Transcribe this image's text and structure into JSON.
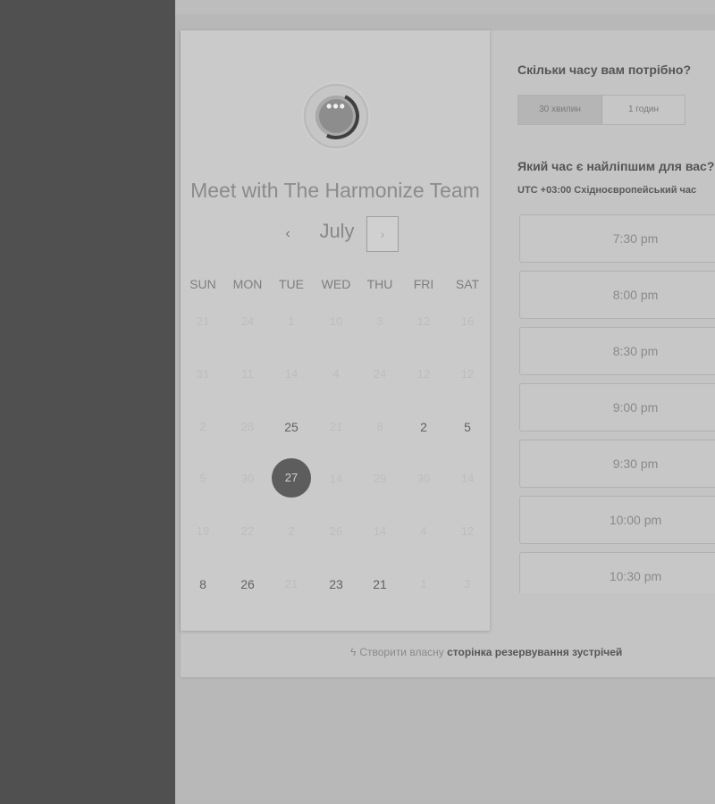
{
  "meeting": {
    "title": "Meet with The Harmonize Team",
    "avatar_icon": "chat-ellipsis-icon"
  },
  "calendar": {
    "month": "July",
    "prev_icon": "‹",
    "next_icon": "›",
    "weekdays": [
      "SUN",
      "MON",
      "TUE",
      "WED",
      "THU",
      "FRI",
      "SAT"
    ],
    "weeks": [
      [
        "21",
        "24",
        "1",
        "10",
        "3",
        "12",
        "16"
      ],
      [
        "31",
        "11",
        "14",
        "4",
        "24",
        "12",
        "12"
      ],
      [
        "2",
        "28",
        "25",
        "21",
        "8",
        "2",
        "5"
      ],
      [
        "5",
        "30",
        "27",
        "14",
        "29",
        "30",
        "14"
      ],
      [
        "19",
        "22",
        "2",
        "26",
        "14",
        "4",
        "12"
      ],
      [
        "8",
        "26",
        "21",
        "23",
        "21",
        "1",
        "3"
      ]
    ]
  },
  "duration": {
    "question": "Скільки часу вам потрібно?",
    "options": [
      "30 хвилин",
      "1 годин"
    ],
    "selected": "30 хвилин"
  },
  "time": {
    "question": "Який час є найліпшим для вас?",
    "tz_offset": "UTC +03:00",
    "tz_name": "Східноєвропейський час",
    "slots": [
      "7:30 pm",
      "8:00 pm",
      "8:30 pm",
      "9:00 pm",
      "9:30 pm",
      "10:00 pm",
      "10:30 pm"
    ]
  },
  "footer": {
    "icon": "sprocket-icon",
    "prefix": "Створити власну",
    "link": "сторінка резервування зустрічей"
  }
}
